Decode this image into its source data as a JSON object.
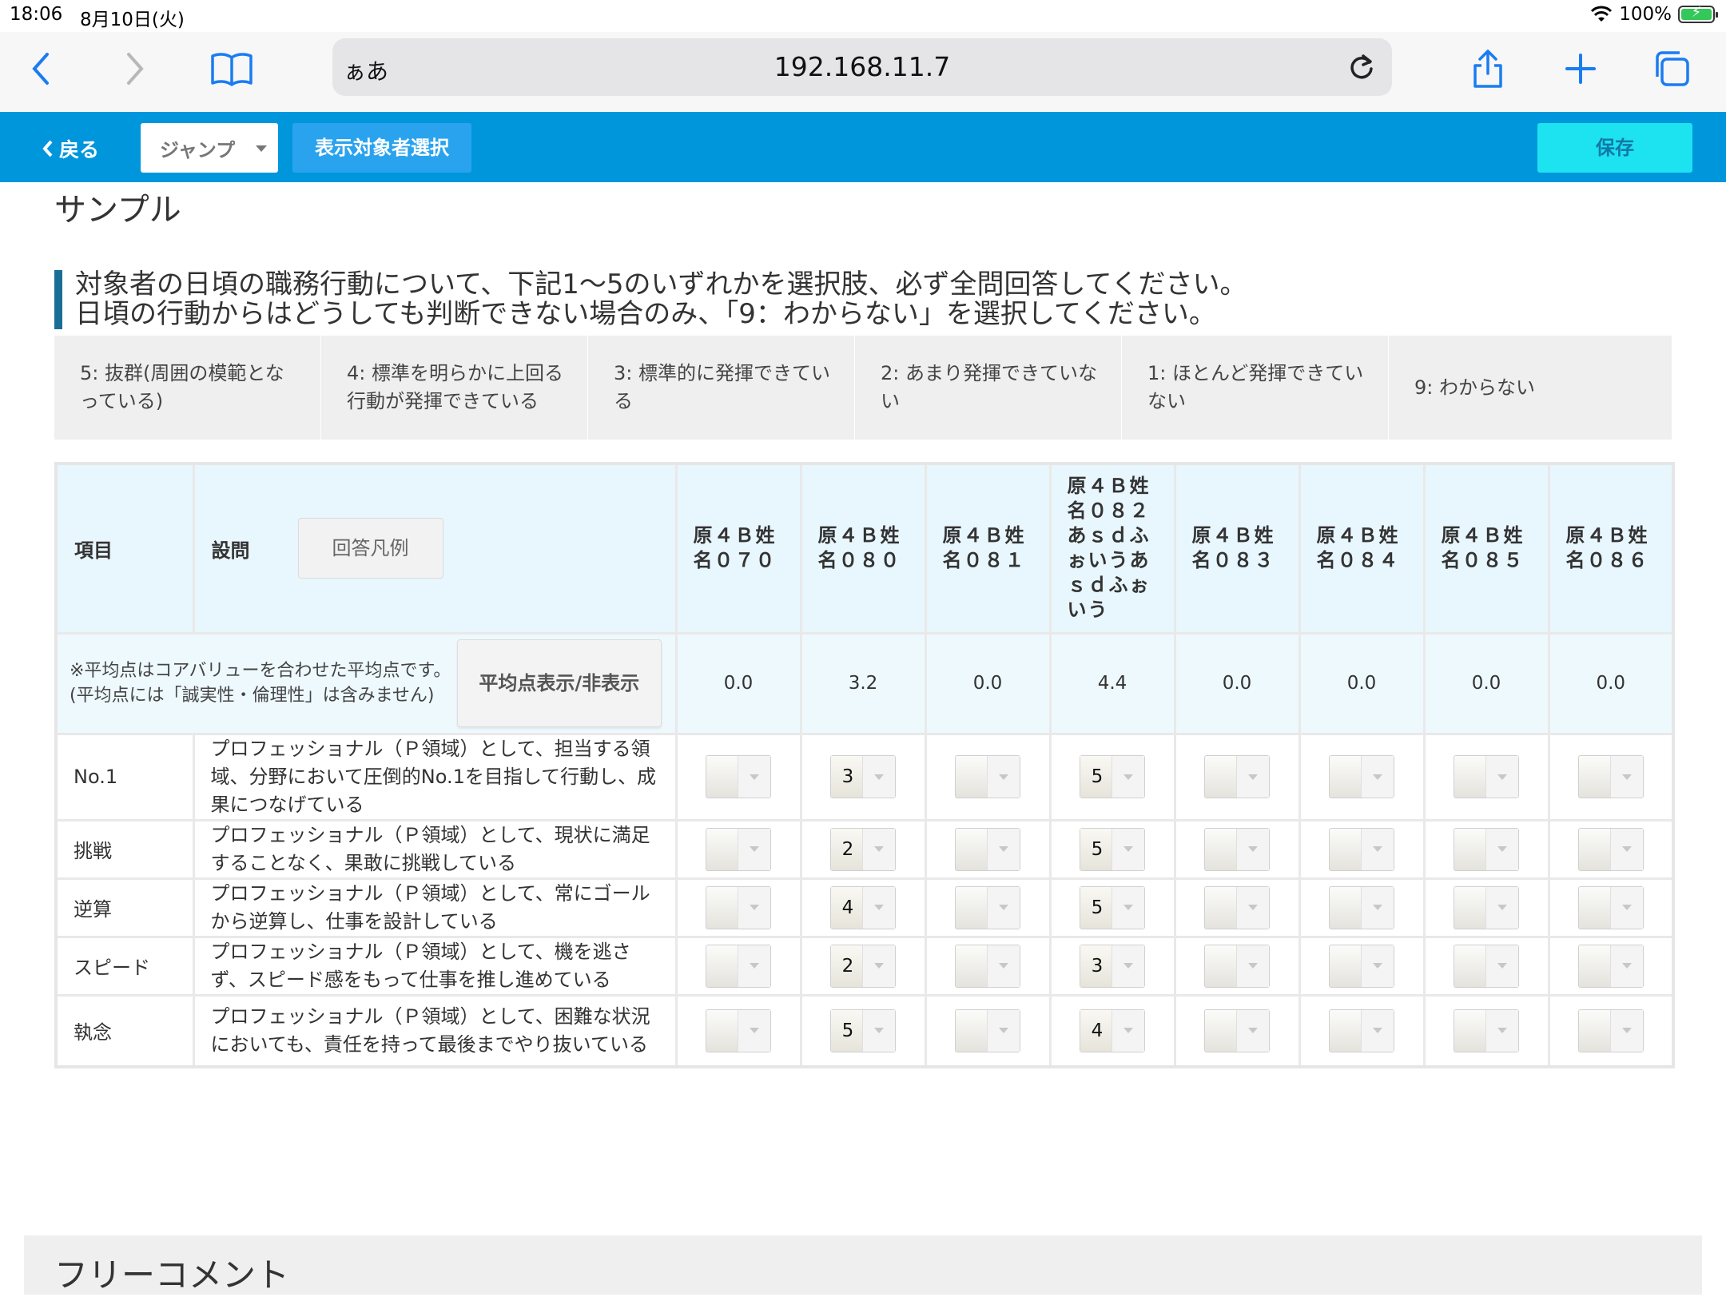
{
  "status_bar": {
    "time": "18:06",
    "date": "8月10日(火)",
    "battery": "100%",
    "battery_level": 1.0
  },
  "browser": {
    "aa_label": "ぁあ",
    "url": "192.168.11.7"
  },
  "header": {
    "back_label": "戻る",
    "jump_label": "ジャンプ",
    "target_select_label": "表示対象者選択",
    "save_label": "保存"
  },
  "page_title": "サンプル",
  "instruction": {
    "line1": "対象者の日頃の職務行動について、下記1〜5のいずれかを選択肢、必ず全問回答してください。",
    "line2": "日頃の行動からはどうしても判断できない場合のみ、「9：わからない」を選択してください。"
  },
  "scale_legend": [
    "5: 抜群(周囲の模範となっている)",
    "4: 標準を明らかに上回る行動が発揮できている",
    "3: 標準的に発揮できている",
    "2: あまり発揮できていない",
    "1: ほとんど発揮できていない",
    "9: わからない"
  ],
  "table": {
    "col_item": "項目",
    "col_question": "設問",
    "legend_button": "回答凡例",
    "employees": [
      "原４Ｂ姓　名０７０",
      "原４Ｂ姓　名０８０",
      "原４Ｂ姓　名０８１",
      "原４Ｂ姓　名０８２あｓｄふぉいうあｓｄふぉいう",
      "原４Ｂ姓　名０８３",
      "原４Ｂ姓　名０８４",
      "原４Ｂ姓　名０８５",
      "原４Ｂ姓　名０８６"
    ],
    "avg_note": "※平均点はコアバリューを合わせた平均点です。(平均点には「誠実性・倫理性」は含みません)",
    "avg_toggle_label": "平均点表示/非表示",
    "averages": [
      "0.0",
      "3.2",
      "0.0",
      "4.4",
      "0.0",
      "0.0",
      "0.0",
      "0.0"
    ],
    "rows": [
      {
        "item": "No.1",
        "question": "プロフェッショナル（Ｐ領域）として、担当する領域、分野において圧倒的No.1を目指して行動し、成果につなげている",
        "answers": [
          "",
          "3",
          "",
          "5",
          "",
          "",
          "",
          ""
        ]
      },
      {
        "item": "挑戦",
        "question": "プロフェッショナル（Ｐ領域）として、現状に満足することなく、果敢に挑戦している",
        "answers": [
          "",
          "2",
          "",
          "5",
          "",
          "",
          "",
          ""
        ]
      },
      {
        "item": "逆算",
        "question": "プロフェッショナル（Ｐ領域）として、常にゴールから逆算し、仕事を設計している",
        "answers": [
          "",
          "4",
          "",
          "5",
          "",
          "",
          "",
          ""
        ]
      },
      {
        "item": "スピード",
        "question": "プロフェッショナル（Ｐ領域）として、機を逃さず、スピード感をもって仕事を推し進めている",
        "answers": [
          "",
          "2",
          "",
          "3",
          "",
          "",
          "",
          ""
        ]
      },
      {
        "item": "執念",
        "question": "プロフェッショナル（Ｐ領域）として、困難な状況においても、責任を持って最後までやり抜いている",
        "answers": [
          "",
          "5",
          "",
          "4",
          "",
          "",
          "",
          ""
        ]
      }
    ]
  },
  "free_comment_title": "フリーコメント",
  "colors": {
    "app_bar": "#0096dc",
    "save_button": "#1de2f0",
    "header_cell": "#e8f6fd",
    "instruction_accent": "#1a6e96"
  }
}
